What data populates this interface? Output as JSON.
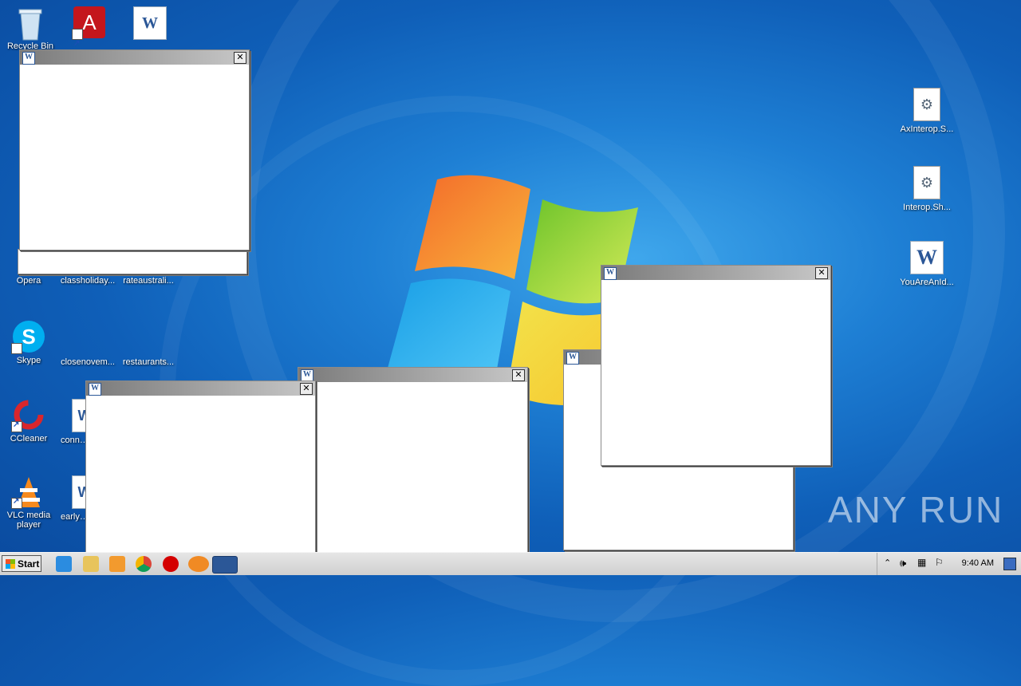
{
  "desktop": {
    "watermark": "ANY RUN",
    "icons": [
      {
        "label": "Recycle Bin",
        "icon": "recycle-bin-icon"
      },
      {
        "label": "",
        "icon": "adobe-acrobat-icon"
      },
      {
        "label": "",
        "icon": "word-document-icon"
      },
      {
        "label": "Opera",
        "icon": "opera-icon"
      },
      {
        "label": "classholiday...",
        "icon": "file-icon"
      },
      {
        "label": "rateaustrali...",
        "icon": "file-icon"
      },
      {
        "label": "Skype",
        "icon": "skype-icon"
      },
      {
        "label": "closenovem...",
        "icon": "file-icon"
      },
      {
        "label": "restaurants...",
        "icon": "file-icon"
      },
      {
        "label": "CCleaner",
        "icon": "ccleaner-icon"
      },
      {
        "label": "conne...",
        "icon": "word-document-icon"
      },
      {
        "label": "VLC media player",
        "icon": "vlc-icon"
      },
      {
        "label": "earlyo...",
        "icon": "word-document-icon"
      },
      {
        "label": "AxInterop.S...",
        "icon": "dll-file-icon"
      },
      {
        "label": "Interop.Sh...",
        "icon": "dll-file-icon"
      },
      {
        "label": "YouAreAnId...",
        "icon": "word-document-icon"
      }
    ]
  },
  "windows": {
    "close_label": "✕"
  },
  "taskbar": {
    "start_label": "Start",
    "clock": "9:40 AM",
    "pinned": [
      "internet-explorer-icon",
      "explorer-icon",
      "media-player-icon",
      "chrome-icon",
      "opera-icon",
      "firefox-icon",
      "word-icon"
    ]
  },
  "colors": {
    "desktop_blue": "#1e7fd4",
    "title_gradient_start": "#7a7a7a",
    "title_gradient_end": "#c8c8c8"
  }
}
